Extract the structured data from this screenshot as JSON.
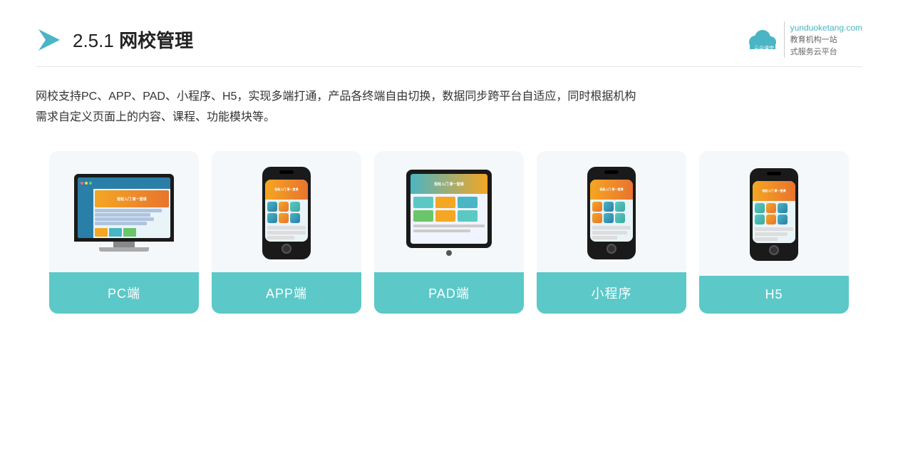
{
  "header": {
    "title_prefix": "2.5.1 ",
    "title_bold": "网校管理",
    "logo_site": "yunduoketang.com",
    "logo_tagline1": "教育机构一站",
    "logo_tagline2": "式服务云平台"
  },
  "description": {
    "text1": "网校支持PC、APP、PAD、小程序、H5，实现多端打通，产品各终端自由切换，数据同步跨平台自适应，同时根据机构",
    "text2": "需求自定义页面上的内容、课程、功能模块等。"
  },
  "cards": [
    {
      "id": "pc",
      "label": "PC端"
    },
    {
      "id": "app",
      "label": "APP端"
    },
    {
      "id": "pad",
      "label": "PAD端"
    },
    {
      "id": "mini",
      "label": "小程序"
    },
    {
      "id": "h5",
      "label": "H5"
    }
  ]
}
